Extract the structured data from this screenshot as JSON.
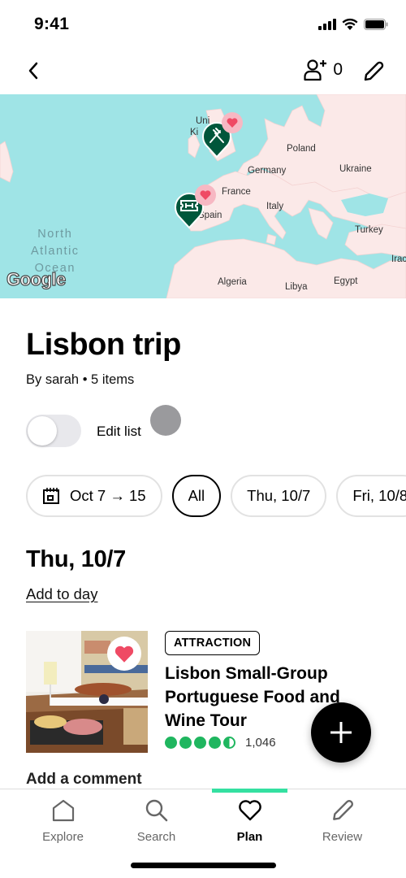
{
  "status_bar": {
    "time": "9:41"
  },
  "nav": {
    "invite_count": "0"
  },
  "map": {
    "labels": {
      "uk_top": "Uni",
      "uk_bottom": "Ki",
      "poland": "Poland",
      "germany": "Germany",
      "ukraine": "Ukraine",
      "france": "France",
      "italy": "Italy",
      "spain": "Spain",
      "turkey": "Turkey",
      "iraq": "Irac",
      "algeria": "Algeria",
      "libya": "Libya",
      "egypt": "Egypt",
      "ocean_line1": "North",
      "ocean_line2": "Atlantic",
      "ocean_line3": "Ocean"
    },
    "attribution": "Google",
    "pins": [
      {
        "type": "restaurant",
        "saved": true
      },
      {
        "type": "attraction",
        "saved": true
      }
    ]
  },
  "trip": {
    "title": "Lisbon trip",
    "subtitle": "By sarah • 5 items",
    "edit_list_label": "Edit list",
    "edit_list_on": false
  },
  "filters": {
    "date_range": "Oct 7 → 15",
    "chips": [
      "All",
      "Thu, 10/7",
      "Fri, 10/8"
    ],
    "selected": "All"
  },
  "day": {
    "heading": "Thu, 10/7",
    "add_to_day": "Add to day"
  },
  "item": {
    "category": "ATTRACTION",
    "title": "Lisbon Small-Group Portuguese Food and Wine Tour",
    "rating": 4.5,
    "rating_max": 5,
    "review_count": "1,046",
    "saved": true,
    "add_comment": "Add a comment"
  },
  "tabs": [
    {
      "label": "Explore",
      "icon": "home-icon",
      "active": false
    },
    {
      "label": "Search",
      "icon": "search-icon",
      "active": false
    },
    {
      "label": "Plan",
      "icon": "heart-icon",
      "active": true
    },
    {
      "label": "Review",
      "icon": "pencil-icon",
      "active": false
    }
  ],
  "colors": {
    "accent": "#34e0a1",
    "pin_green": "#00563b",
    "rating_green": "#1fb65f",
    "heart_red": "#ef4a64",
    "ocean": "#9fe4e6",
    "land": "#fbe9e8"
  }
}
